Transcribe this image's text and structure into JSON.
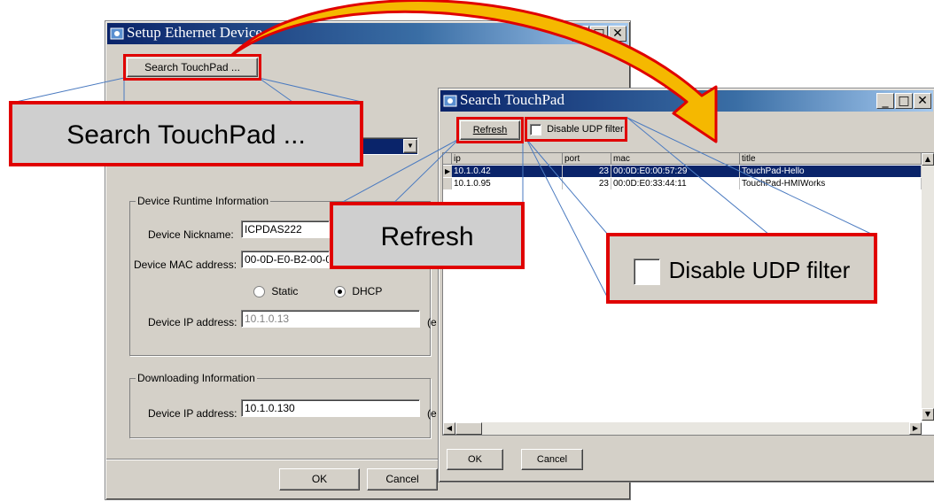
{
  "setup_window": {
    "title": "Setup Ethernet Device",
    "search_button": "Search TouchPad ...",
    "runtime_group": "Device Runtime Information",
    "nickname_label": "Device Nickname:",
    "nickname_value": "ICPDAS222",
    "mac_label": "Device MAC address:",
    "mac_value": "00-0D-E0-B2-00-0",
    "static_label": "Static",
    "dhcp_label": "DHCP",
    "ip_label": "Device IP address:",
    "ip_value": "10.1.0.13",
    "ip_suffix": "(e",
    "download_group": "Downloading Information",
    "dl_ip_label": "Device IP address:",
    "dl_ip_value": "10.1.0.130",
    "dl_ip_suffix": "(e",
    "ok_button": "OK",
    "cancel_button": "Cancel"
  },
  "search_window": {
    "title": "Search TouchPad",
    "refresh_button": "Refresh",
    "disable_udp_label": "Disable UDP filter",
    "columns": [
      "ip",
      "port",
      "mac",
      "title"
    ],
    "rows": [
      {
        "ip": "10.1.0.42",
        "port": "23",
        "mac": "00:0D:E0:00:57:29",
        "title": "TouchPad-Hello"
      },
      {
        "ip": "10.1.0.95",
        "port": "23",
        "mac": "00:0D:E0:33:44:11",
        "title": "TouchPad-HMIWorks"
      }
    ],
    "ok_button": "OK",
    "cancel_button": "Cancel"
  },
  "callouts": {
    "search": "Search TouchPad ...",
    "refresh": "Refresh",
    "udp": "Disable UDP filter"
  },
  "colors": {
    "highlight": "#e00000",
    "arrow_fill": "#f5b800",
    "arrow_outline": "#e00000",
    "title_bar": "#0a246a"
  }
}
